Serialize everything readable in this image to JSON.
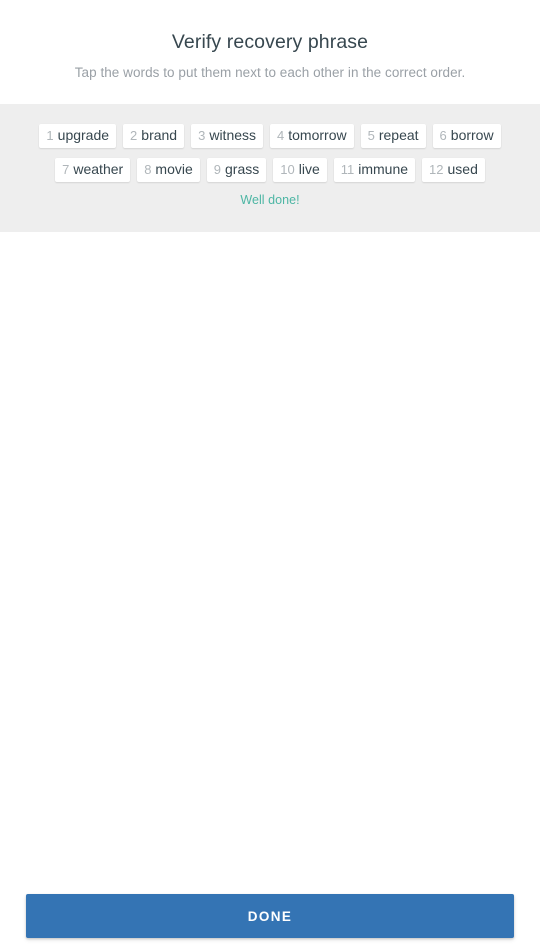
{
  "header": {
    "title": "Verify recovery phrase",
    "subtitle": "Tap the words to put them next to each other in the correct order."
  },
  "words_panel": {
    "status_message": "Well done!",
    "status_color": "#4db6a4",
    "panel_background": "#eeeeee",
    "rows": [
      [
        {
          "index": "1",
          "word": "upgrade"
        },
        {
          "index": "2",
          "word": "brand"
        },
        {
          "index": "3",
          "word": "witness"
        },
        {
          "index": "4",
          "word": "tomorrow"
        },
        {
          "index": "5",
          "word": "repeat"
        },
        {
          "index": "6",
          "word": "borrow"
        }
      ],
      [
        {
          "index": "7",
          "word": "weather"
        },
        {
          "index": "8",
          "word": "movie"
        },
        {
          "index": "9",
          "word": "grass"
        },
        {
          "index": "10",
          "word": "live"
        },
        {
          "index": "11",
          "word": "immune"
        },
        {
          "index": "12",
          "word": "used"
        }
      ]
    ]
  },
  "footer": {
    "done_label": "Done",
    "accent_color": "#3474b4"
  }
}
